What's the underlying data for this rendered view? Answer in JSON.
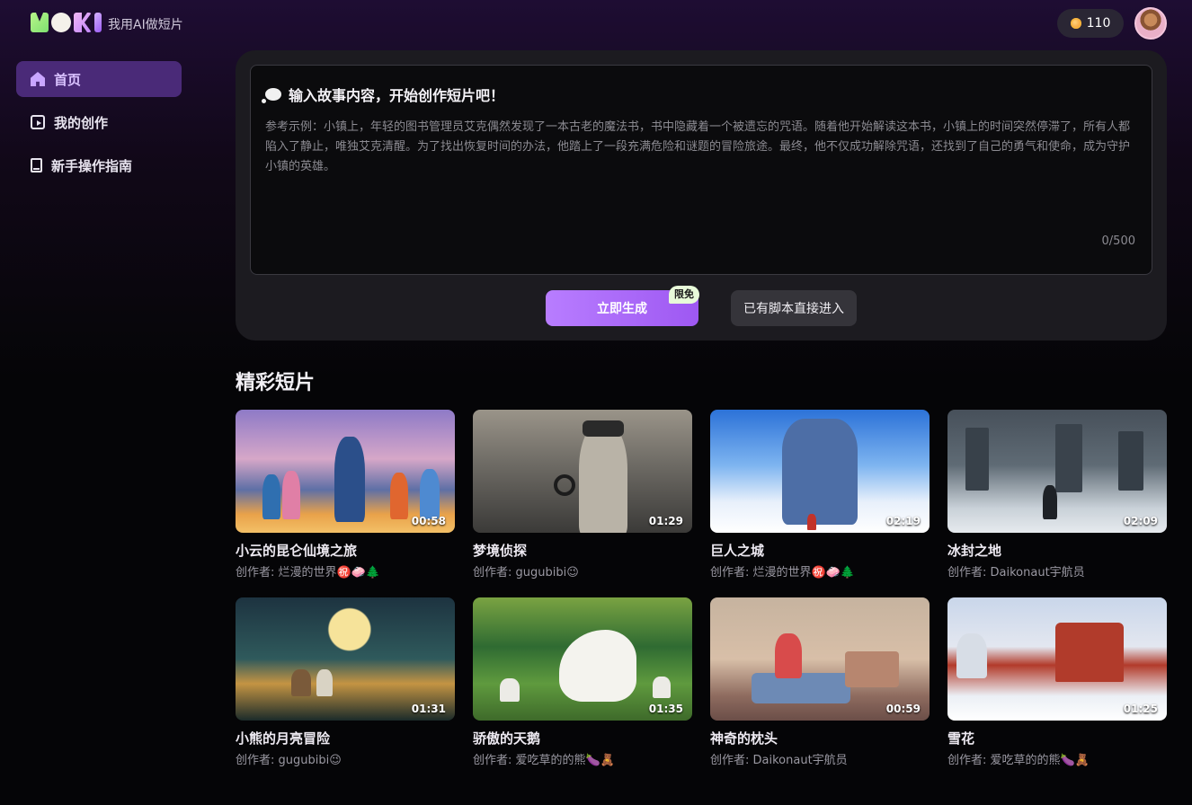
{
  "app": {
    "tagline": "我用AI做短片",
    "credits": "110"
  },
  "sidebar": {
    "items": [
      {
        "label": "首页",
        "icon": "home-icon",
        "active": true
      },
      {
        "label": "我的创作",
        "icon": "video-icon",
        "active": false
      },
      {
        "label": "新手操作指南",
        "icon": "book-icon",
        "active": false
      }
    ]
  },
  "story": {
    "title": "输入故事内容，开始创作短片吧！",
    "placeholder": "参考示例：小镇上，年轻的图书管理员艾克偶然发现了一本古老的魔法书，书中隐藏着一个被遗忘的咒语。随着他开始解读这本书，小镇上的时间突然停滞了，所有人都陷入了静止，唯独艾克清醒。为了找出恢复时间的办法，他踏上了一段充满危险和谜题的冒险旅途。最终，他不仅成功解除咒语，还找到了自己的勇气和使命，成为守护小镇的英雄。",
    "counter": "0/500",
    "generate_label": "立即生成",
    "free_badge": "限免",
    "script_label": "已有脚本直接进入"
  },
  "gallery": {
    "title": "精彩短片",
    "cards": [
      {
        "title": "小云的昆仑仙境之旅",
        "author": "创作者: 烂漫的世界㊗️🧼🌲",
        "duration": "00:58"
      },
      {
        "title": "梦境侦探",
        "author": "创作者: gugubibi😉",
        "duration": "01:29"
      },
      {
        "title": "巨人之城",
        "author": "创作者: 烂漫的世界㊗️🧼🌲",
        "duration": "02:19"
      },
      {
        "title": "冰封之地",
        "author": "创作者: Daikonaut宇航员",
        "duration": "02:09"
      },
      {
        "title": "小熊的月亮冒险",
        "author": "创作者: gugubibi😉",
        "duration": "01:31"
      },
      {
        "title": "骄傲的天鹅",
        "author": "创作者: 爱吃草的的熊🍆🧸",
        "duration": "01:35"
      },
      {
        "title": "神奇的枕头",
        "author": "创作者: Daikonaut宇航员",
        "duration": "00:59"
      },
      {
        "title": "雪花",
        "author": "创作者: 爱吃草的的熊🍆🧸",
        "duration": "01:25"
      }
    ]
  }
}
